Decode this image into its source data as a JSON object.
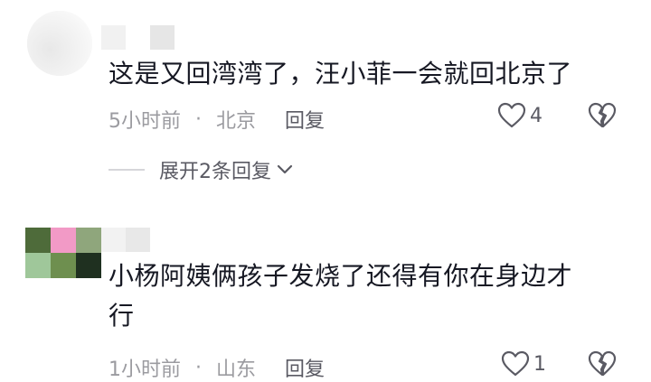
{
  "comments": [
    {
      "text_lines": [
        "这是又回湾湾了，汪小菲一会就回北京了"
      ],
      "time": "5小时前",
      "separator": "·",
      "location": "北京",
      "reply_label": "回复",
      "like_count": "4",
      "expand_label": "展开2条回复"
    },
    {
      "text_lines": [
        "小杨阿姨俩孩子发烧了还得有你在身边才",
        "行"
      ],
      "time": "1小时前",
      "separator": "·",
      "location": "山东",
      "reply_label": "回复",
      "like_count": "1"
    }
  ],
  "icons": {
    "like": "heart-outline-icon",
    "dislike": "broken-heart-icon",
    "expand": "chevron-down-icon"
  }
}
